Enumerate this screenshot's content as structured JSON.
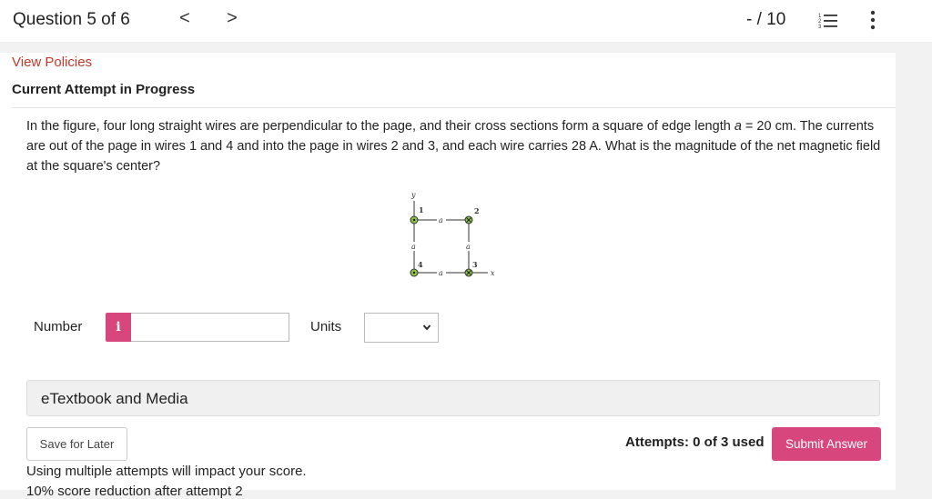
{
  "header": {
    "question_title": "Question 5 of 6",
    "prev_symbol": "<",
    "next_symbol": ">",
    "score": "- / 10",
    "list_icon": "list-icon",
    "more_icon": "kebab-icon"
  },
  "panel": {
    "view_policies": "View Policies",
    "attempt_status": "Current Attempt in Progress"
  },
  "question": {
    "text_before_a": "In the figure, four long straight wires are perpendicular to the page, and their cross sections form a square of edge length ",
    "variable": "a",
    "text_after_a": " = 20 cm. The currents are out of the page in wires 1 and 4 and into the page in wires 2 and 3, and each wire carries 28 A. What is the magnitude of the net magnetic field at the square's center?"
  },
  "figure": {
    "y_label": "y",
    "x_label": "x",
    "edge_label": "a",
    "wire_labels": [
      "1",
      "2",
      "3",
      "4"
    ]
  },
  "answer": {
    "number_label": "Number",
    "info_symbol": "i",
    "number_value": "",
    "units_label": "Units",
    "units_selected": ""
  },
  "etextbook": {
    "label": "eTextbook and Media"
  },
  "footer": {
    "save_label": "Save for Later",
    "attempts": "Attempts: 0 of 3 used",
    "submit_label": "Submit Answer",
    "note1": "Using multiple attempts will impact your score.",
    "note2": "10% score reduction after attempt 2"
  },
  "colors": {
    "accent": "#d8467e",
    "link": "#c0392b",
    "wire_fill": "#8bc34a"
  }
}
